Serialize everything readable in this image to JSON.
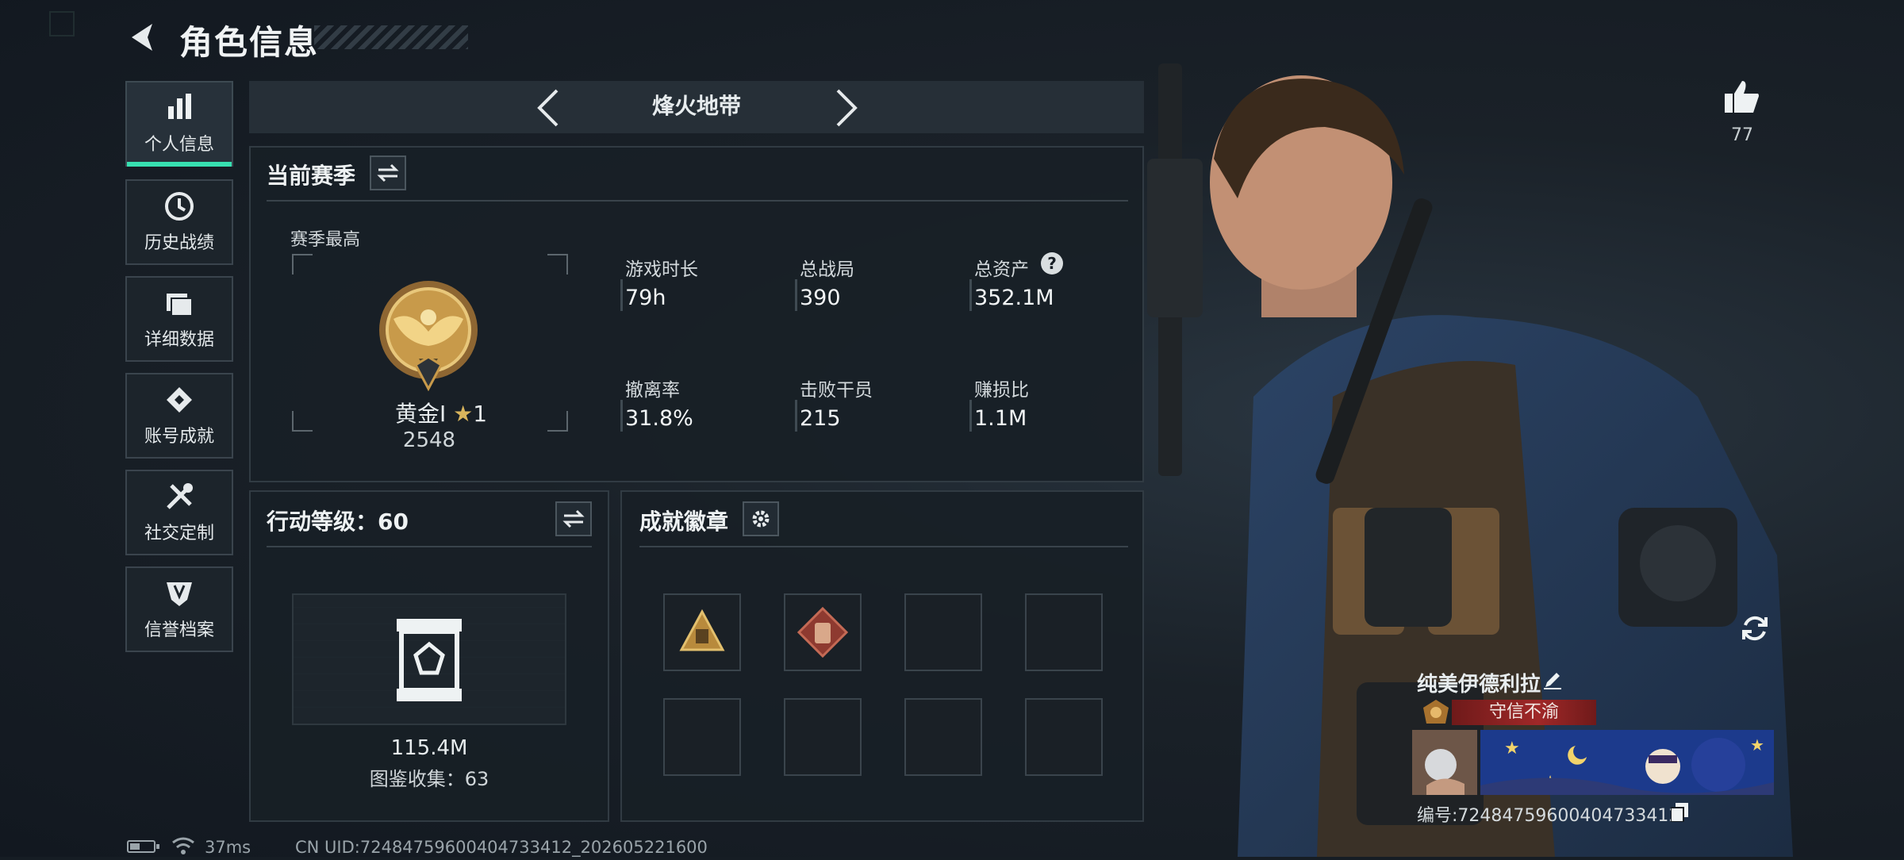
{
  "header": {
    "title": "角色信息"
  },
  "sidebar": {
    "items": [
      {
        "label": "个人信息",
        "icon": "bar-chart-icon",
        "active": true
      },
      {
        "label": "历史战绩",
        "icon": "clock-icon",
        "active": false
      },
      {
        "label": "详细数据",
        "icon": "folder-icon",
        "active": false
      },
      {
        "label": "账号成就",
        "icon": "achievement-icon",
        "active": false
      },
      {
        "label": "社交定制",
        "icon": "tools-icon",
        "active": false
      },
      {
        "label": "信誉档案",
        "icon": "shield-icon",
        "active": false
      }
    ]
  },
  "mode_selector": {
    "label": "烽火地带"
  },
  "season": {
    "title": "当前赛季",
    "best_label": "赛季最高",
    "rank_name": "黄金I",
    "rank_stars": "1",
    "rank_score": "2548",
    "stats": [
      {
        "label": "游戏时长",
        "value": "79h"
      },
      {
        "label": "总战局",
        "value": "390"
      },
      {
        "label": "总资产",
        "value": "352.1M",
        "help": "?"
      },
      {
        "label": "撤离率",
        "value": "31.8%"
      },
      {
        "label": "击败干员",
        "value": "215"
      },
      {
        "label": "赚损比",
        "value": "1.1M"
      }
    ]
  },
  "action_level": {
    "title": "行动等级：60",
    "value": "115.4M",
    "collection": "图鉴收集：63"
  },
  "achievements": {
    "title": "成就徽章",
    "slots_total": 8,
    "filled": [
      "pyramid-badge-icon",
      "vest-badge-icon"
    ]
  },
  "profile": {
    "likes": "77",
    "name": "纯美伊德利拉",
    "title_tag": "守信不渝",
    "id_text": "编号:72484759600404733412"
  },
  "status_bar": {
    "ping": "37ms",
    "uid": "CN UID:72484759600404733412_202605221600"
  },
  "colors": {
    "accent": "#37e0b0",
    "tag_red": "#8a1c1c",
    "gold": "#c89a4a"
  }
}
